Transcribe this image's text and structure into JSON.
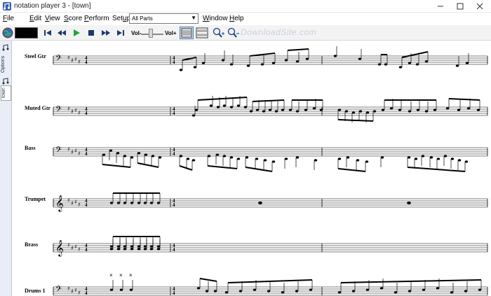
{
  "window": {
    "title": "notation player 3 - [town]"
  },
  "menu": [
    {
      "id": "file",
      "label": "File",
      "ul": "F"
    },
    {
      "id": "edit",
      "label": "Edit",
      "ul": "E"
    },
    {
      "id": "view",
      "label": "View",
      "ul": "V"
    },
    {
      "id": "score",
      "label": "Score",
      "ul": "S"
    },
    {
      "id": "perform",
      "label": "Perform",
      "ul": "P"
    },
    {
      "id": "setup",
      "label": "Setup",
      "ul": "u"
    },
    {
      "id": "window",
      "label": "Window",
      "ul": "W"
    },
    {
      "id": "help",
      "label": "Help",
      "ul": "H"
    }
  ],
  "parts_select": {
    "value": "All Parts"
  },
  "toolbar": {
    "vol_minus": "Vol-",
    "vol_plus": "Vol+",
    "volume_level": 0.45
  },
  "watermark": "DownloadSite.com",
  "side_tabs": {
    "options": "Options",
    "town": "town"
  },
  "score": {
    "key_signature": "E major (4 sharps)",
    "time_signature": "4/4",
    "instruments": [
      "Steel Gtr",
      "Muted Gtr",
      "Bass",
      "Trumpet",
      "Brass",
      "Drums 1"
    ]
  },
  "icons": [
    "app-icon",
    "minimize-icon",
    "maximize-icon",
    "close-icon",
    "globe-icon",
    "skip-to-start-icon",
    "rewind-icon",
    "play-icon",
    "stop-icon",
    "fast-forward-icon",
    "skip-to-end-icon",
    "page-view-icon",
    "scroll-view-icon",
    "zoom-in-icon",
    "zoom-out-icon"
  ]
}
